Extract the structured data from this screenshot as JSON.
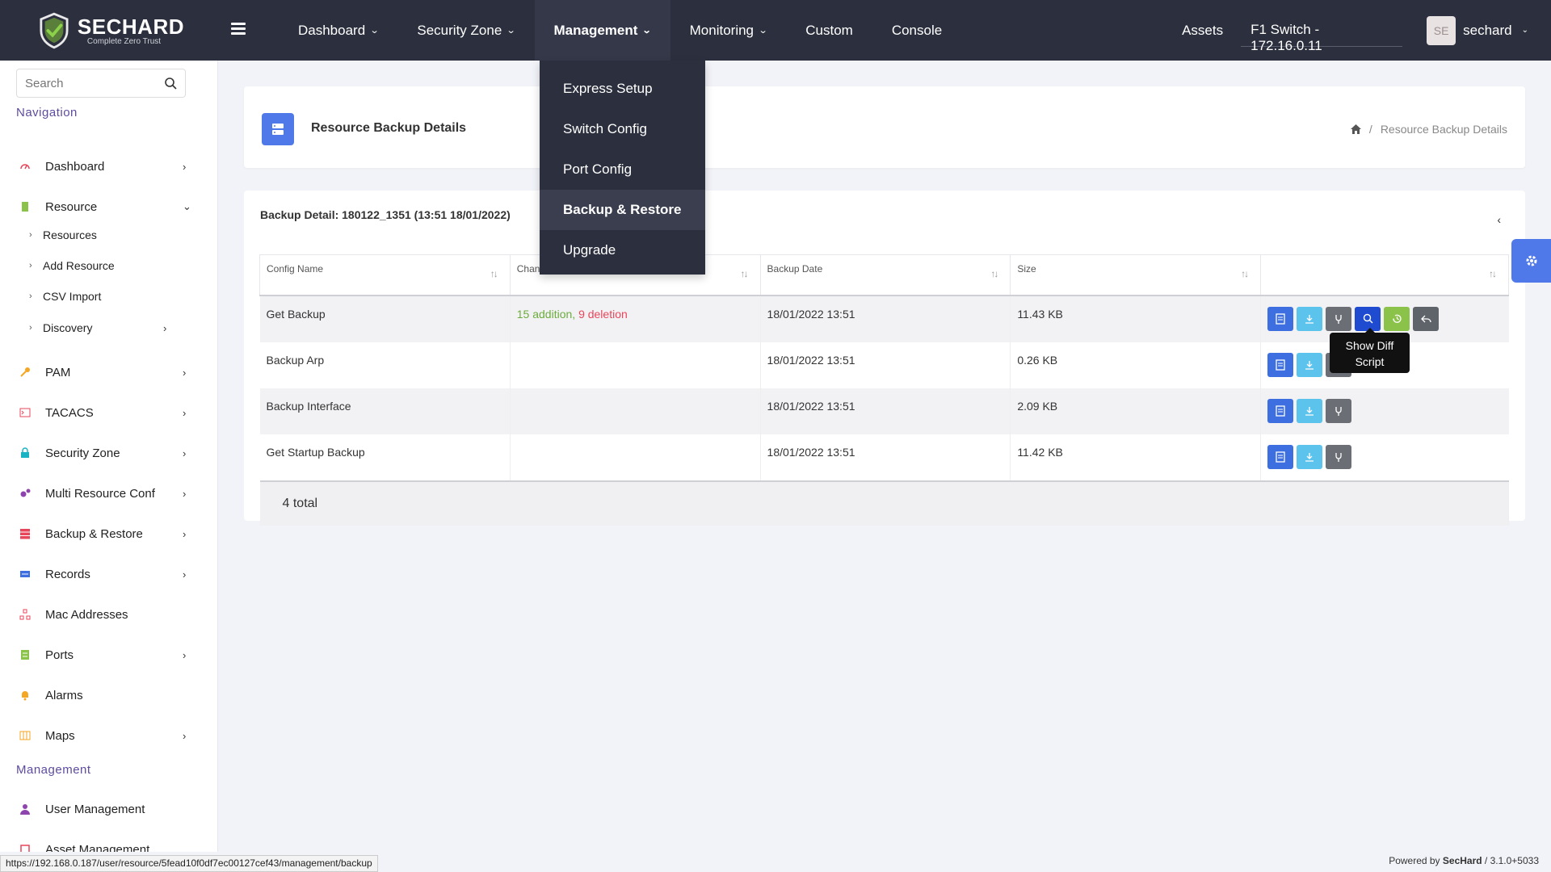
{
  "brand": {
    "name_prefix": "SEC",
    "name_suffix": "HARD",
    "tagline": "Complete Zero Trust"
  },
  "topnav": {
    "items": [
      {
        "label": "Dashboard"
      },
      {
        "label": "Security Zone"
      },
      {
        "label": "Management"
      },
      {
        "label": "Monitoring"
      },
      {
        "label": "Custom"
      },
      {
        "label": "Console"
      }
    ],
    "assets": "Assets",
    "device": "F1 Switch - 172.16.0.11",
    "avatar_initials": "SE",
    "username": "sechard"
  },
  "management_menu": [
    {
      "label": "Express Setup"
    },
    {
      "label": "Switch Config"
    },
    {
      "label": "Port Config"
    },
    {
      "label": "Backup & Restore"
    },
    {
      "label": "Upgrade"
    }
  ],
  "sidebar": {
    "search_placeholder": "Search",
    "nav_title": "Navigation",
    "items": [
      {
        "label": "Dashboard",
        "icon": "dashboard-icon",
        "color": "#e8465b"
      },
      {
        "label": "Resource",
        "icon": "resource-icon",
        "color": "#8bc34a"
      },
      {
        "label": "PAM",
        "icon": "key-icon",
        "color": "#f5a623"
      },
      {
        "label": "TACACS",
        "icon": "terminal-icon",
        "color": "#e8465b"
      },
      {
        "label": "Security Zone",
        "icon": "lock-icon",
        "color": "#19b3c4"
      },
      {
        "label": "Multi Resource Conf",
        "icon": "cogs-icon",
        "color": "#8e44ad"
      },
      {
        "label": "Backup & Restore",
        "icon": "database-icon",
        "color": "#e8465b"
      },
      {
        "label": "Records",
        "icon": "records-icon",
        "color": "#3d6fe0"
      },
      {
        "label": "Mac Addresses",
        "icon": "network-icon",
        "color": "#e8465b"
      },
      {
        "label": "Ports",
        "icon": "ports-icon",
        "color": "#8bc34a"
      },
      {
        "label": "Alarms",
        "icon": "bell-icon",
        "color": "#f5a623"
      },
      {
        "label": "Maps",
        "icon": "map-icon",
        "color": "#f5a623"
      }
    ],
    "resource_subitems": [
      {
        "label": "Resources"
      },
      {
        "label": "Add Resource"
      },
      {
        "label": "CSV Import"
      },
      {
        "label": "Discovery"
      }
    ],
    "mgmt_title": "Management",
    "mgmt_items": [
      {
        "label": "User Management",
        "icon": "user-icon",
        "color": "#8e44ad"
      },
      {
        "label": "Asset Management",
        "icon": "asset-icon",
        "color": "#e8465b"
      }
    ]
  },
  "page": {
    "title": "Resource Backup Details",
    "breadcrumb": "Resource Backup Details"
  },
  "backup": {
    "title": "Backup Detail: 180122_1351 (13:51 18/01/2022)",
    "columns": [
      "Config Name",
      "Changes",
      "Backup Date",
      "Size",
      ""
    ],
    "rows": [
      {
        "name": "Get Backup",
        "add": "15 addition",
        "sep": ", ",
        "del": "9 deletion",
        "date": "18/01/2022 13:51",
        "size": "11.43 KB"
      },
      {
        "name": "Backup Arp",
        "add": "",
        "sep": "",
        "del": "",
        "date": "18/01/2022 13:51",
        "size": "0.26 KB"
      },
      {
        "name": "Backup Interface",
        "add": "",
        "sep": "",
        "del": "",
        "date": "18/01/2022 13:51",
        "size": "2.09 KB"
      },
      {
        "name": "Get Startup Backup",
        "add": "",
        "sep": "",
        "del": "",
        "date": "18/01/2022 13:51",
        "size": "11.42 KB"
      }
    ],
    "total": "4 total",
    "tooltip_line1": "Show Diff",
    "tooltip_line2": "Script"
  },
  "status": {
    "url": "https://192.168.0.187/user/resource/5fead10f0df7ec00127cef43/management/backup",
    "powered_prefix": "Powered by ",
    "powered_brand": "SecHard",
    "version": " / 3.1.0+5033"
  }
}
